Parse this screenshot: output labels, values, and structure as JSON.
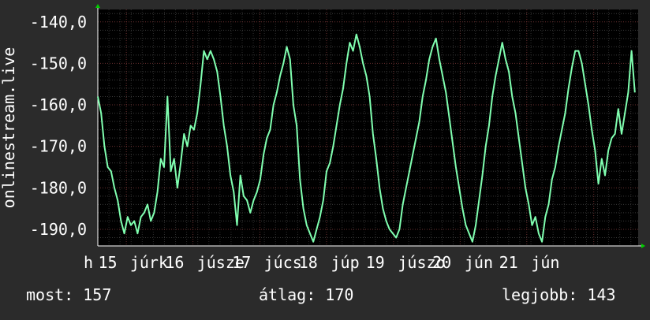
{
  "chart_data": {
    "type": "line",
    "ylabel": "onlinestream.live",
    "ylim": [
      -194,
      -137
    ],
    "y_ticks": [
      -140,
      -150,
      -160,
      -170,
      -180,
      -190
    ],
    "y_tick_labels": [
      "-140,0",
      "-150,0",
      "-160,0",
      "-170,0",
      "-180,0",
      "-190,0"
    ],
    "x_range": [
      0,
      163
    ],
    "x_tick_positions": [
      0,
      8.6,
      28.7,
      48.9,
      69.0,
      89.2,
      109.3,
      129.4,
      149.6
    ],
    "x_tick_labels": [
      "h",
      "15",
      "júrk",
      "16",
      "júsze",
      "17",
      "júcs",
      "18",
      "júp",
      "19",
      "júszo",
      "20",
      "jún",
      "21",
      "jún"
    ],
    "x_label_items": [
      {
        "text": "h",
        "x": 0
      },
      {
        "text": "15",
        "x": 4.4
      },
      {
        "text": "júrk",
        "x": 14.0
      },
      {
        "text": "16",
        "x": 24.6
      },
      {
        "text": "júsze",
        "x": 34.2
      },
      {
        "text": "17",
        "x": 44.8
      },
      {
        "text": "júcs",
        "x": 54.4
      },
      {
        "text": "18",
        "x": 64.9
      },
      {
        "text": "júp",
        "x": 74.6
      },
      {
        "text": "19",
        "x": 85.1
      },
      {
        "text": "júszo",
        "x": 94.8
      },
      {
        "text": "20",
        "x": 105.2
      },
      {
        "text": "jún",
        "x": 114.9
      },
      {
        "text": "21",
        "x": 125.3
      },
      {
        "text": "jún",
        "x": 135.0
      }
    ],
    "grid": true,
    "series": [
      {
        "color": "#80ffb0",
        "values": [
          -158,
          -162,
          -170,
          -175,
          -176,
          -180,
          -183,
          -188,
          -191,
          -187,
          -189,
          -188,
          -191,
          -187,
          -186,
          -184,
          -188,
          -186,
          -181,
          -173,
          -175,
          -158,
          -176,
          -173,
          -180,
          -174,
          -167,
          -170,
          -165,
          -166,
          -162,
          -155,
          -147,
          -149,
          -147,
          -149,
          -152,
          -158,
          -165,
          -170,
          -177,
          -181,
          -189,
          -177,
          -182,
          -183,
          -186,
          -183,
          -181,
          -178,
          -172,
          -168,
          -166,
          -160,
          -157,
          -153,
          -150,
          -146,
          -149,
          -160,
          -165,
          -178,
          -185,
          -189,
          -191,
          -193,
          -190,
          -187,
          -183,
          -176,
          -174,
          -170,
          -165,
          -160,
          -156,
          -150,
          -145,
          -147,
          -143,
          -146,
          -150,
          -153,
          -158,
          -167,
          -173,
          -180,
          -185,
          -188,
          -190,
          -191,
          -192,
          -190,
          -184,
          -180,
          -176,
          -172,
          -168,
          -164,
          -158,
          -154,
          -149,
          -146,
          -144,
          -149,
          -153,
          -157,
          -163,
          -169,
          -175,
          -180,
          -185,
          -189,
          -191,
          -193,
          -189,
          -183,
          -177,
          -170,
          -165,
          -158,
          -153,
          -149,
          -145,
          -149,
          -152,
          -158,
          -162,
          -168,
          -174,
          -180,
          -184,
          -189,
          -187,
          -191,
          -193,
          -187,
          -184,
          -178,
          -175,
          -170,
          -166,
          -162,
          -156,
          -151,
          -147,
          -147,
          -150,
          -155,
          -160,
          -166,
          -171,
          -179,
          -173,
          -177,
          -171,
          -168,
          -167,
          -161,
          -167,
          -162,
          -157,
          -147,
          -157
        ]
      }
    ]
  },
  "footer": {
    "now": "most: 157",
    "avg": "átlag: 170",
    "best": "legjobb: 143"
  }
}
